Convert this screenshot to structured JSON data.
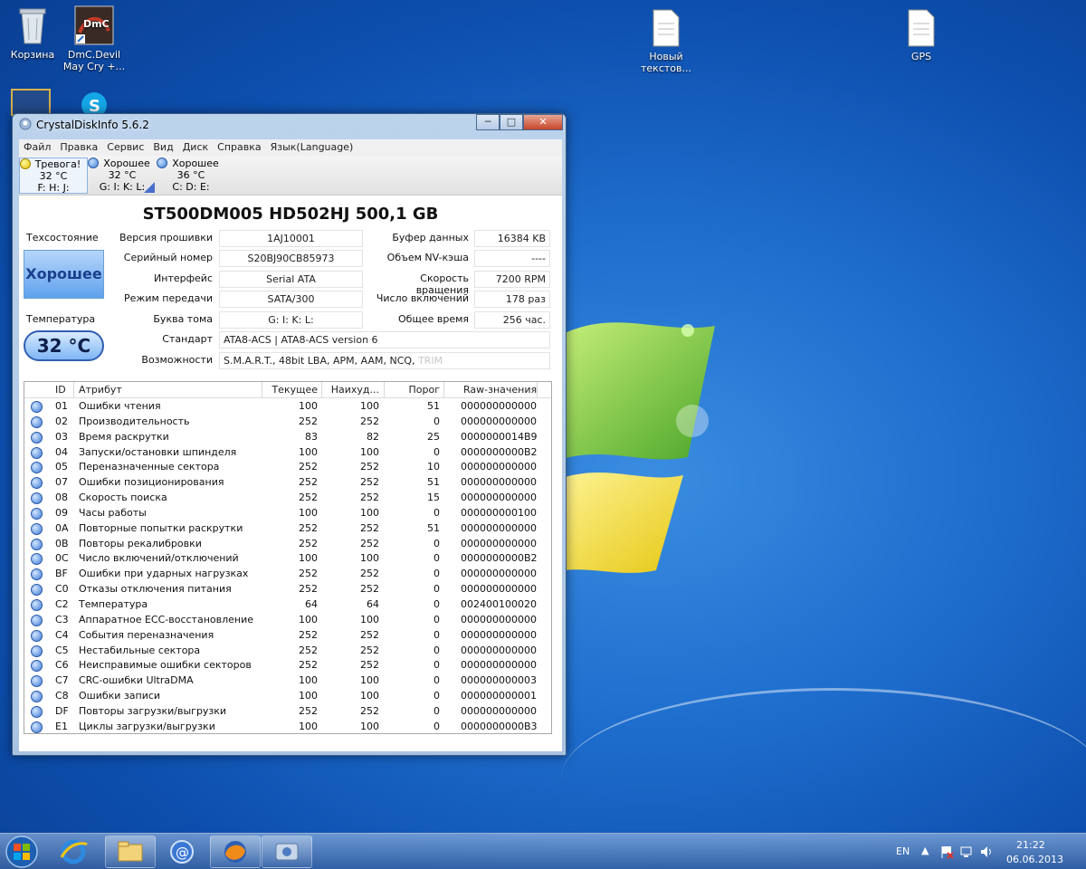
{
  "desktop": {
    "icons": [
      {
        "label": "Корзина"
      },
      {
        "label": "DmC.Devil May Cry +..."
      },
      {
        "label": "Новый текстов..."
      },
      {
        "label": "GPS"
      }
    ]
  },
  "window": {
    "title": "CrystalDiskInfo 5.6.2",
    "menu": [
      "Файл",
      "Правка",
      "Сервис",
      "Вид",
      "Диск",
      "Справка",
      "Язык(Language)"
    ],
    "disks": [
      {
        "status": "Тревога!",
        "temp": "32 °C",
        "letters": "F: H: J:",
        "color": "yellow"
      },
      {
        "status": "Хорошее",
        "temp": "32 °C",
        "letters": "G: I: K: L:",
        "color": "blue"
      },
      {
        "status": "Хорошее",
        "temp": "36 °C",
        "letters": "C: D: E:",
        "color": "blue"
      }
    ],
    "model": "ST500DM005 HD502HJ  500,1 GB",
    "health_label": "Техсостояние",
    "health_value": "Хорошее",
    "temp_label": "Температура",
    "temp_value": "32 °C",
    "info": {
      "firmware_label": "Версия прошивки",
      "firmware": "1AJ10001",
      "serial_label": "Серийный номер",
      "serial": "S20BJ90CB85973",
      "interface_label": "Интерфейс",
      "interface": "Serial ATA",
      "transfer_label": "Режим передачи",
      "transfer": "SATA/300",
      "letter_label": "Буква тома",
      "letter": "G: I: K: L:",
      "standard_label": "Стандарт",
      "standard": "ATA8-ACS | ATA8-ACS version 6",
      "features_label": "Возможности",
      "features": "S.M.A.R.T., 48bit LBA, APM, AAM, NCQ,",
      "features_dim": "TRIM",
      "buffer_label": "Буфер данных",
      "buffer": "16384 KB",
      "nvcache_label": "Объем NV-кэша",
      "nvcache": "----",
      "rotation_label": "Скорость вращения",
      "rotation": "7200 RPM",
      "poweron_label": "Число включений",
      "poweron": "178 раз",
      "hours_label": "Общее время",
      "hours": "256 час."
    },
    "table": {
      "headers": [
        "ID",
        "Атрибут",
        "Текущее",
        "Наихуд...",
        "Порог",
        "Raw-значения"
      ],
      "rows": [
        [
          "01",
          "Ошибки чтения",
          "100",
          "100",
          "51",
          "000000000000"
        ],
        [
          "02",
          "Производительность",
          "252",
          "252",
          "0",
          "000000000000"
        ],
        [
          "03",
          "Время раскрутки",
          "83",
          "82",
          "25",
          "0000000014B9"
        ],
        [
          "04",
          "Запуски/остановки шпинделя",
          "100",
          "100",
          "0",
          "0000000000B2"
        ],
        [
          "05",
          "Переназначенные сектора",
          "252",
          "252",
          "10",
          "000000000000"
        ],
        [
          "07",
          "Ошибки позиционирования",
          "252",
          "252",
          "51",
          "000000000000"
        ],
        [
          "08",
          "Скорость поиска",
          "252",
          "252",
          "15",
          "000000000000"
        ],
        [
          "09",
          "Часы работы",
          "100",
          "100",
          "0",
          "000000000100"
        ],
        [
          "0A",
          "Повторные попытки раскрутки",
          "252",
          "252",
          "51",
          "000000000000"
        ],
        [
          "0B",
          "Повторы рекалибровки",
          "252",
          "252",
          "0",
          "000000000000"
        ],
        [
          "0C",
          "Число включений/отключений",
          "100",
          "100",
          "0",
          "0000000000B2"
        ],
        [
          "BF",
          "Ошибки при ударных нагрузках",
          "252",
          "252",
          "0",
          "000000000000"
        ],
        [
          "C0",
          "Отказы отключения питания",
          "252",
          "252",
          "0",
          "000000000000"
        ],
        [
          "C2",
          "Температура",
          "64",
          "64",
          "0",
          "002400100020"
        ],
        [
          "C3",
          "Аппаратное ECC-восстановление",
          "100",
          "100",
          "0",
          "000000000000"
        ],
        [
          "C4",
          "События переназначения",
          "252",
          "252",
          "0",
          "000000000000"
        ],
        [
          "C5",
          "Нестабильные сектора",
          "252",
          "252",
          "0",
          "000000000000"
        ],
        [
          "C6",
          "Неисправимые ошибки секторов",
          "252",
          "252",
          "0",
          "000000000000"
        ],
        [
          "C7",
          "CRC-ошибки UltraDMA",
          "100",
          "100",
          "0",
          "000000000003"
        ],
        [
          "C8",
          "Ошибки записи",
          "100",
          "100",
          "0",
          "000000000001"
        ],
        [
          "DF",
          "Повторы загрузки/выгрузки",
          "252",
          "252",
          "0",
          "000000000000"
        ],
        [
          "E1",
          "Циклы загрузки/выгрузки",
          "100",
          "100",
          "0",
          "0000000000B3"
        ]
      ]
    }
  },
  "taskbar": {
    "lang": "EN",
    "time": "21:22",
    "date": "06.06.2013"
  }
}
